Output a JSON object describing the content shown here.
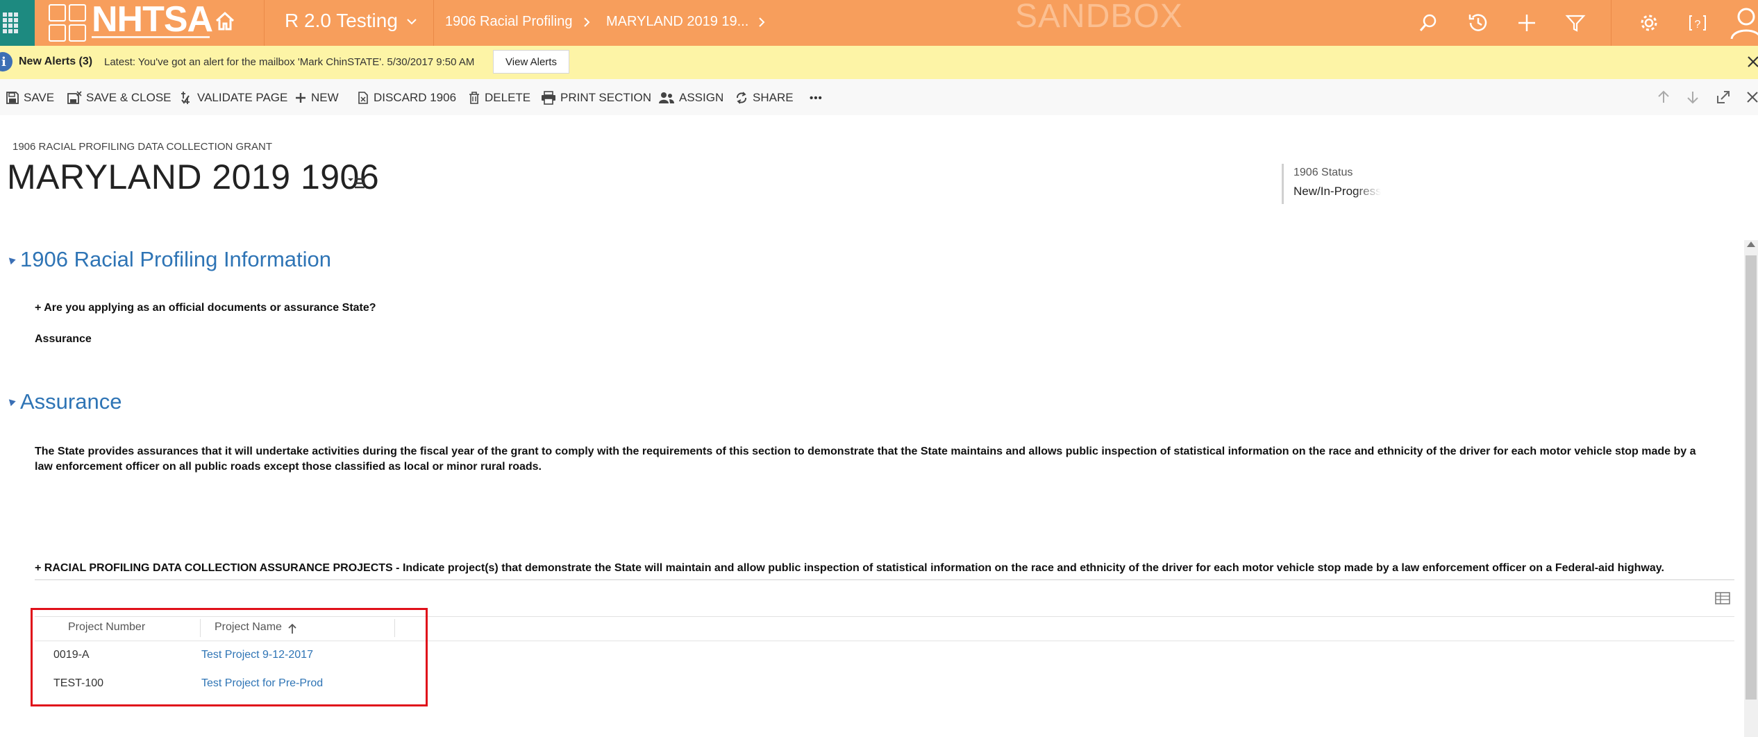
{
  "topnav": {
    "logo_text": "NHTSA",
    "app_name": "R 2.0 Testing",
    "breadcrumb": [
      "1906 Racial Profiling",
      "MARYLAND 2019 19..."
    ],
    "environment_watermark": "SANDBOX",
    "icons": [
      "app-launcher-icon",
      "home-icon",
      "search-icon",
      "history-icon",
      "plus-icon",
      "filter-icon",
      "gear-icon",
      "help-icon",
      "user-avatar-icon"
    ],
    "colors": {
      "bar": "#f79e5c",
      "launcher": "#1d8a80"
    }
  },
  "alerts": {
    "title": "New Alerts (3)",
    "message": "Latest: You've got an alert for the mailbox 'Mark ChinSTATE'. 5/30/2017 9:50 AM",
    "view_button": "View Alerts"
  },
  "commandbar": {
    "save": "SAVE",
    "save_close": "SAVE & CLOSE",
    "validate": "VALIDATE PAGE",
    "new": "NEW",
    "discard": "DISCARD 1906",
    "delete": "DELETE",
    "print": "PRINT SECTION",
    "assign": "ASSIGN",
    "share": "SHARE",
    "more": "•••"
  },
  "header": {
    "entity_type": "1906 RACIAL PROFILING DATA COLLECTION GRANT",
    "record_title": "MARYLAND 2019 1906",
    "status_label": "1906 Status",
    "status_value": "New/In-Progress"
  },
  "section1": {
    "title": "1906 Racial Profiling Information",
    "question": "+ Are you applying as an official documents or assurance State?",
    "answer": "Assurance"
  },
  "section2": {
    "title": "Assurance",
    "body": "The State provides assurances that it will undertake activities during the fiscal year of the grant to comply with the requirements of this section to demonstrate that the State maintains and allows public inspection of statistical information on the race and ethnicity of the driver for each motor vehicle stop made by a law enforcement officer on all public roads except those classified as local or minor rural roads.",
    "grid_label": "+ RACIAL PROFILING DATA COLLECTION ASSURANCE PROJECTS - Indicate project(s) that demonstrate the State will maintain and allow public inspection of statistical information on the race and ethnicity of the driver for each motor vehicle stop made by a law enforcement officer on a Federal-aid highway.",
    "grid": {
      "columns": [
        "Project Number",
        "Project Name"
      ],
      "sort_column": "Project Name",
      "sort_direction": "ascending",
      "rows": [
        {
          "number": "0019-A",
          "name": "Test Project 9-12-2017"
        },
        {
          "number": "TEST-100",
          "name": "Test Project for Pre-Prod"
        }
      ]
    }
  }
}
